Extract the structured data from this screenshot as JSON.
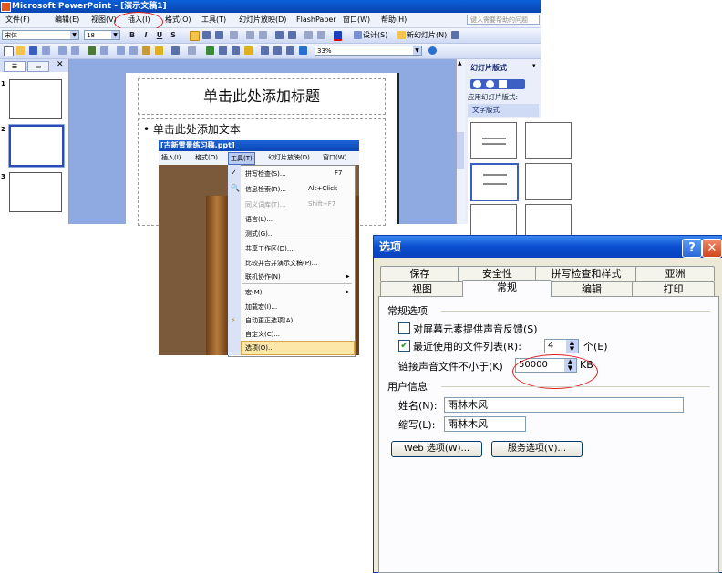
{
  "ppt": {
    "title": "Microsoft PowerPoint - [演示文稿1]",
    "menus": [
      "文件(F)",
      "编辑(E)",
      "视图(V)",
      "插入(I)",
      "格式(O)",
      "工具(T)",
      "幻灯片放映(D)",
      "FlashPaper",
      "窗口(W)",
      "帮助(H)"
    ],
    "help_placeholder": "键入需要帮助的问题",
    "font_name": "宋体",
    "font_size": "18",
    "format_buttons": [
      "B",
      "I",
      "U",
      "S"
    ],
    "design_label": "设计(S)",
    "new_slide_label": "新幻灯片(N)",
    "zoom": "33%",
    "slide_numbers": [
      "1",
      "2",
      "3"
    ],
    "slide_title_placeholder": "单击此处添加标题",
    "slide_body_placeholder": "• 单击此处添加文本",
    "task_pane": {
      "title": "幻灯片版式",
      "apply_label": "应用幻灯片版式:",
      "section_label": "文字版式"
    }
  },
  "embedded": {
    "title": "[古新雪景练习稿.ppt]",
    "menus": [
      "插入(I)",
      "格式(O)",
      "工具(T)",
      "幻灯片放映(D)",
      "窗口(W)"
    ],
    "items": [
      {
        "label": "拼写检查(S)...",
        "key": "F7",
        "disabled": false
      },
      {
        "label": "信息检索(R)...",
        "key": "Alt+Click",
        "disabled": false
      },
      {
        "label": "同义词库(T)...",
        "key": "Shift+F7",
        "disabled": true
      },
      {
        "label": "语言(L)...",
        "key": "",
        "disabled": false
      },
      {
        "label": "测式(G)...",
        "key": "",
        "disabled": false
      },
      {
        "label": "共享工作区(D)...",
        "key": "",
        "disabled": false
      },
      {
        "label": "比较并合并演示文稿(P)...",
        "key": "",
        "disabled": false
      },
      {
        "label": "联机协作(N)",
        "key": "",
        "disabled": false
      },
      {
        "label": "宏(M)",
        "key": "",
        "disabled": false
      },
      {
        "label": "加载宏(I)...",
        "key": "",
        "disabled": false
      },
      {
        "label": "自动更正选项(A)...",
        "key": "",
        "disabled": false
      },
      {
        "label": "自定义(C)...",
        "key": "",
        "disabled": false
      },
      {
        "label": "选项(O)...",
        "key": "",
        "disabled": false
      }
    ]
  },
  "dialog": {
    "title": "选项",
    "help_glyph": "?",
    "close_glyph": "✕",
    "tabs_row1": [
      "保存",
      "安全性",
      "拼写检查和样式",
      "亚洲"
    ],
    "tabs_row2": [
      "视图",
      "常规",
      "编辑",
      "打印"
    ],
    "general_group": "常规选项",
    "feedback_label": "对屏幕元素提供声音反馈(S)",
    "feedback_checked": false,
    "recent_label": "最近使用的文件列表(R):",
    "recent_checked": true,
    "recent_value": "4",
    "recent_unit": "个(E)",
    "link_label": "链接声音文件不小于(K)",
    "link_value": "50000",
    "link_unit": "KB",
    "user_group": "用户信息",
    "name_label": "姓名(N):",
    "name_value": "雨林木风",
    "initials_label": "缩写(L):",
    "initials_value": "雨林木风",
    "web_button": "Web 选项(W)...",
    "service_button": "服务选项(V)..."
  }
}
